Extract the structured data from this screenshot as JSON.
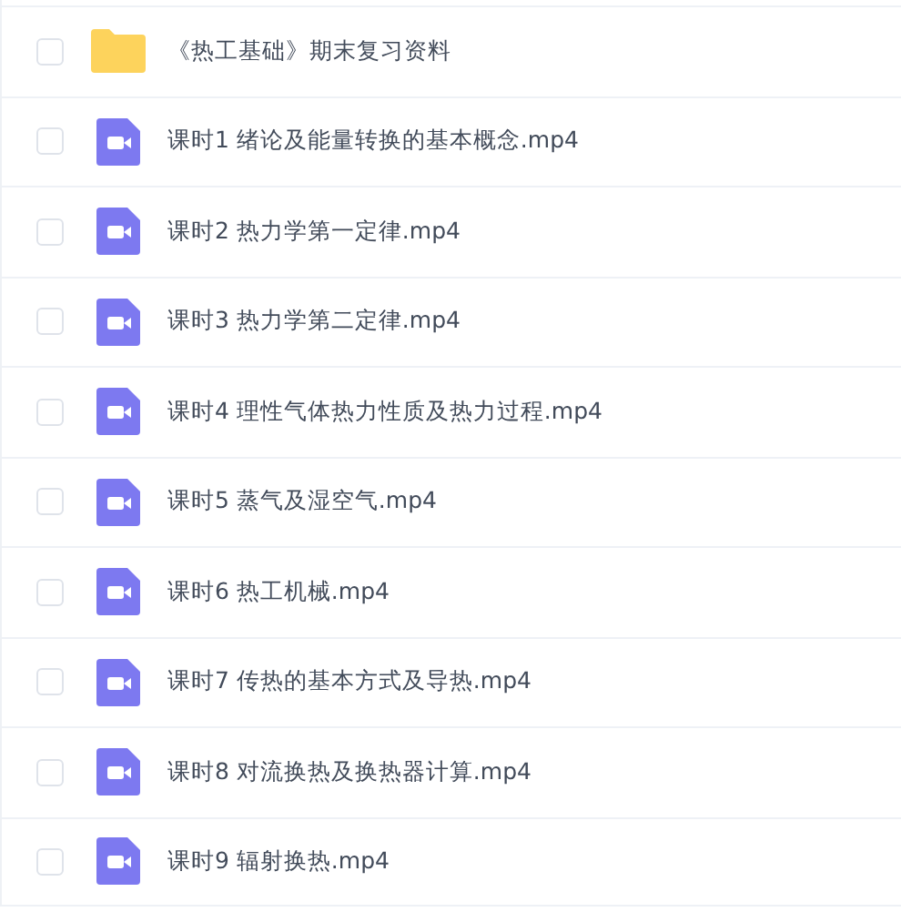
{
  "files": [
    {
      "kind": "folder",
      "name": "《热工基础》期末复习资料",
      "checked": false
    },
    {
      "kind": "video",
      "name": "课时1 绪论及能量转换的基本概念.mp4",
      "checked": false
    },
    {
      "kind": "video",
      "name": "课时2 热力学第一定律.mp4",
      "checked": false
    },
    {
      "kind": "video",
      "name": "课时3 热力学第二定律.mp4",
      "checked": false
    },
    {
      "kind": "video",
      "name": "课时4 理性气体热力性质及热力过程.mp4",
      "checked": false
    },
    {
      "kind": "video",
      "name": "课时5 蒸气及湿空气.mp4",
      "checked": false
    },
    {
      "kind": "video",
      "name": "课时6 热工机械.mp4",
      "checked": false
    },
    {
      "kind": "video",
      "name": "课时7 传热的基本方式及导热.mp4",
      "checked": false
    },
    {
      "kind": "video",
      "name": "课时8 对流换热及换热器计算.mp4",
      "checked": false
    },
    {
      "kind": "video",
      "name": "课时9 辐射换热.mp4",
      "checked": false
    }
  ]
}
